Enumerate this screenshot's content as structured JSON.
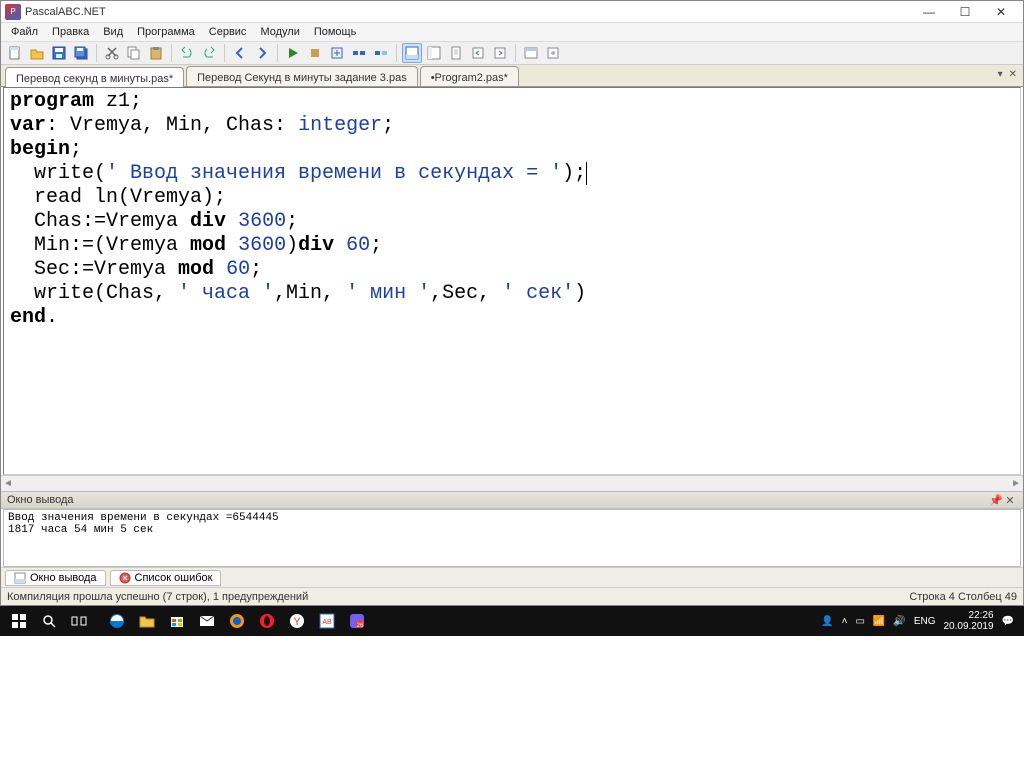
{
  "title": "PascalABC.NET",
  "menubar": {
    "file": "Файл",
    "edit": "Правка",
    "view": "Вид",
    "program": "Программа",
    "service": "Сервис",
    "modules": "Модули",
    "help": "Помощь"
  },
  "tabs": [
    {
      "label": "Перевод секунд в минуты.pas*",
      "active": true
    },
    {
      "label": "Перевод Секунд в минуты задание 3.pas",
      "active": false
    },
    {
      "label": "•Program2.pas*",
      "active": false
    }
  ],
  "code": {
    "l1_a": "program",
    "l1_b": " z1;",
    "l2_a": "var",
    "l2_b": ": Vremya, Min, Chas: ",
    "l2_c": "integer",
    "l2_d": ";",
    "l3_a": "begin",
    "l3_b": ";",
    "l4_a": "  write(",
    "l4_b": "' Ввод значения времени в секундах = '",
    "l4_c": ");",
    "l5": "  read ln(Vremya);",
    "l6_a": "  Chas:=Vremya ",
    "l6_b": "div",
    "l6_c": " ",
    "l6_d": "3600",
    "l6_e": ";",
    "l7_a": "  Min:=(Vremya ",
    "l7_b": "mod",
    "l7_c": " ",
    "l7_d": "3600",
    "l7_e": ")",
    "l7_f": "div",
    "l7_g": " ",
    "l7_h": "60",
    "l7_i": ";",
    "l8_a": "  Sec:=Vremya ",
    "l8_b": "mod",
    "l8_c": " ",
    "l8_d": "60",
    "l8_e": ";",
    "l9_a": "  write(Chas, ",
    "l9_b": "' часа '",
    "l9_c": ",Min, ",
    "l9_d": "' мин '",
    "l9_e": ",Sec, ",
    "l9_f": "' сек'",
    "l9_g": ")",
    "l10_a": "end",
    "l10_b": "."
  },
  "output_panel": {
    "title": "Окно вывода",
    "line1": "Ввод значения времени в секундах =6544445",
    "line2": "1817 часа 54 мин 5 сек"
  },
  "bottom_tabs": {
    "output": "Окно вывода",
    "errors": "Список ошибок"
  },
  "status": {
    "left": "Компиляция прошла успешно (7 строк), 1 предупреждений",
    "right": "Строка 4 Столбец 49"
  },
  "tray": {
    "lang": "ENG",
    "time": "22:26",
    "date": "20.09.2019"
  }
}
